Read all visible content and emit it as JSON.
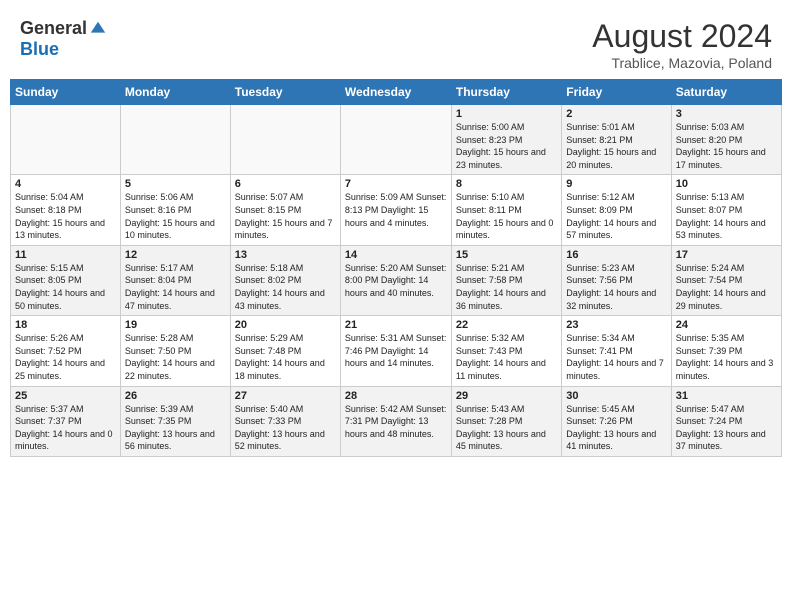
{
  "header": {
    "logo_general": "General",
    "logo_blue": "Blue",
    "title": "August 2024",
    "location": "Trablice, Mazovia, Poland"
  },
  "days_of_week": [
    "Sunday",
    "Monday",
    "Tuesday",
    "Wednesday",
    "Thursday",
    "Friday",
    "Saturday"
  ],
  "weeks": [
    [
      {
        "day": "",
        "info": ""
      },
      {
        "day": "",
        "info": ""
      },
      {
        "day": "",
        "info": ""
      },
      {
        "day": "",
        "info": ""
      },
      {
        "day": "1",
        "info": "Sunrise: 5:00 AM\nSunset: 8:23 PM\nDaylight: 15 hours\nand 23 minutes."
      },
      {
        "day": "2",
        "info": "Sunrise: 5:01 AM\nSunset: 8:21 PM\nDaylight: 15 hours\nand 20 minutes."
      },
      {
        "day": "3",
        "info": "Sunrise: 5:03 AM\nSunset: 8:20 PM\nDaylight: 15 hours\nand 17 minutes."
      }
    ],
    [
      {
        "day": "4",
        "info": "Sunrise: 5:04 AM\nSunset: 8:18 PM\nDaylight: 15 hours\nand 13 minutes."
      },
      {
        "day": "5",
        "info": "Sunrise: 5:06 AM\nSunset: 8:16 PM\nDaylight: 15 hours\nand 10 minutes."
      },
      {
        "day": "6",
        "info": "Sunrise: 5:07 AM\nSunset: 8:15 PM\nDaylight: 15 hours\nand 7 minutes."
      },
      {
        "day": "7",
        "info": "Sunrise: 5:09 AM\nSunset: 8:13 PM\nDaylight: 15 hours\nand 4 minutes."
      },
      {
        "day": "8",
        "info": "Sunrise: 5:10 AM\nSunset: 8:11 PM\nDaylight: 15 hours\nand 0 minutes."
      },
      {
        "day": "9",
        "info": "Sunrise: 5:12 AM\nSunset: 8:09 PM\nDaylight: 14 hours\nand 57 minutes."
      },
      {
        "day": "10",
        "info": "Sunrise: 5:13 AM\nSunset: 8:07 PM\nDaylight: 14 hours\nand 53 minutes."
      }
    ],
    [
      {
        "day": "11",
        "info": "Sunrise: 5:15 AM\nSunset: 8:05 PM\nDaylight: 14 hours\nand 50 minutes."
      },
      {
        "day": "12",
        "info": "Sunrise: 5:17 AM\nSunset: 8:04 PM\nDaylight: 14 hours\nand 47 minutes."
      },
      {
        "day": "13",
        "info": "Sunrise: 5:18 AM\nSunset: 8:02 PM\nDaylight: 14 hours\nand 43 minutes."
      },
      {
        "day": "14",
        "info": "Sunrise: 5:20 AM\nSunset: 8:00 PM\nDaylight: 14 hours\nand 40 minutes."
      },
      {
        "day": "15",
        "info": "Sunrise: 5:21 AM\nSunset: 7:58 PM\nDaylight: 14 hours\nand 36 minutes."
      },
      {
        "day": "16",
        "info": "Sunrise: 5:23 AM\nSunset: 7:56 PM\nDaylight: 14 hours\nand 32 minutes."
      },
      {
        "day": "17",
        "info": "Sunrise: 5:24 AM\nSunset: 7:54 PM\nDaylight: 14 hours\nand 29 minutes."
      }
    ],
    [
      {
        "day": "18",
        "info": "Sunrise: 5:26 AM\nSunset: 7:52 PM\nDaylight: 14 hours\nand 25 minutes."
      },
      {
        "day": "19",
        "info": "Sunrise: 5:28 AM\nSunset: 7:50 PM\nDaylight: 14 hours\nand 22 minutes."
      },
      {
        "day": "20",
        "info": "Sunrise: 5:29 AM\nSunset: 7:48 PM\nDaylight: 14 hours\nand 18 minutes."
      },
      {
        "day": "21",
        "info": "Sunrise: 5:31 AM\nSunset: 7:46 PM\nDaylight: 14 hours\nand 14 minutes."
      },
      {
        "day": "22",
        "info": "Sunrise: 5:32 AM\nSunset: 7:43 PM\nDaylight: 14 hours\nand 11 minutes."
      },
      {
        "day": "23",
        "info": "Sunrise: 5:34 AM\nSunset: 7:41 PM\nDaylight: 14 hours\nand 7 minutes."
      },
      {
        "day": "24",
        "info": "Sunrise: 5:35 AM\nSunset: 7:39 PM\nDaylight: 14 hours\nand 3 minutes."
      }
    ],
    [
      {
        "day": "25",
        "info": "Sunrise: 5:37 AM\nSunset: 7:37 PM\nDaylight: 14 hours\nand 0 minutes."
      },
      {
        "day": "26",
        "info": "Sunrise: 5:39 AM\nSunset: 7:35 PM\nDaylight: 13 hours\nand 56 minutes."
      },
      {
        "day": "27",
        "info": "Sunrise: 5:40 AM\nSunset: 7:33 PM\nDaylight: 13 hours\nand 52 minutes."
      },
      {
        "day": "28",
        "info": "Sunrise: 5:42 AM\nSunset: 7:31 PM\nDaylight: 13 hours\nand 48 minutes."
      },
      {
        "day": "29",
        "info": "Sunrise: 5:43 AM\nSunset: 7:28 PM\nDaylight: 13 hours\nand 45 minutes."
      },
      {
        "day": "30",
        "info": "Sunrise: 5:45 AM\nSunset: 7:26 PM\nDaylight: 13 hours\nand 41 minutes."
      },
      {
        "day": "31",
        "info": "Sunrise: 5:47 AM\nSunset: 7:24 PM\nDaylight: 13 hours\nand 37 minutes."
      }
    ]
  ]
}
